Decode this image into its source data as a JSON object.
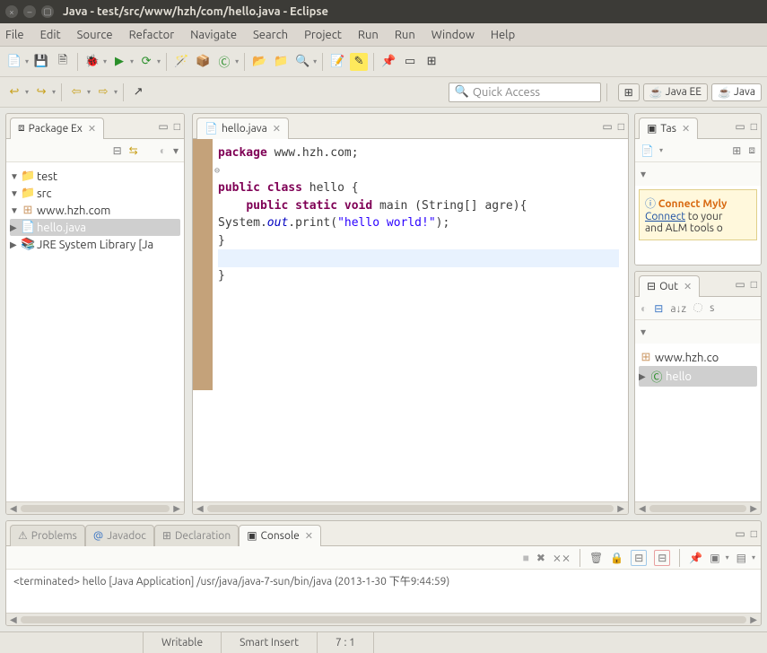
{
  "window": {
    "title": "Java - test/src/www/hzh/com/hello.java - Eclipse"
  },
  "menu": {
    "file": "File",
    "edit": "Edit",
    "source": "Source",
    "refactor": "Refactor",
    "navigate": "Navigate",
    "search": "Search",
    "project": "Project",
    "run": "Run",
    "run2": "Run",
    "window": "Window",
    "help": "Help"
  },
  "quick": {
    "placeholder": "Quick Access"
  },
  "perspectives": {
    "javaee": "Java EE",
    "java": "Java"
  },
  "package_explorer": {
    "title": "Package Ex",
    "tree": {
      "project": "test",
      "src": "src",
      "pkg": "www.hzh.com",
      "file": "hello.java",
      "jre": "JRE System Library [Ja"
    }
  },
  "editor": {
    "tab": "hello.java",
    "code": {
      "l1_kw": "package",
      "l1_rest": " www.hzh.com;",
      "l2_kw1": "public",
      "l2_kw2": "class",
      "l2_rest": " hello {",
      "l3_kw1": "public",
      "l3_kw2": "static",
      "l3_kw3": "void",
      "l3_rest": " main (String[] agre){",
      "l4_pre": "        System.",
      "l4_out": "out",
      "l4_mid": ".print(",
      "l4_str": "\"hello world!\"",
      "l4_end": ");",
      "l5": "    }",
      "l6": "",
      "l7": "}"
    }
  },
  "task": {
    "title": "Tas",
    "mylyn_h": "Connect Myly",
    "mylyn_link": "Connect",
    "mylyn_t1": " to your ",
    "mylyn_t2": "and ALM tools o"
  },
  "outline": {
    "title": "Out",
    "pkg": "www.hzh.co",
    "cls": "hello"
  },
  "bottom": {
    "problems": "Problems",
    "javadoc": "Javadoc",
    "declaration": "Declaration",
    "console": "Console",
    "console_line": "<terminated> hello [Java Application] /usr/java/java-7-sun/bin/java (2013-1-30 下午9:44:59)"
  },
  "status": {
    "writable": "Writable",
    "insert": "Smart Insert",
    "pos": "7 : 1"
  }
}
